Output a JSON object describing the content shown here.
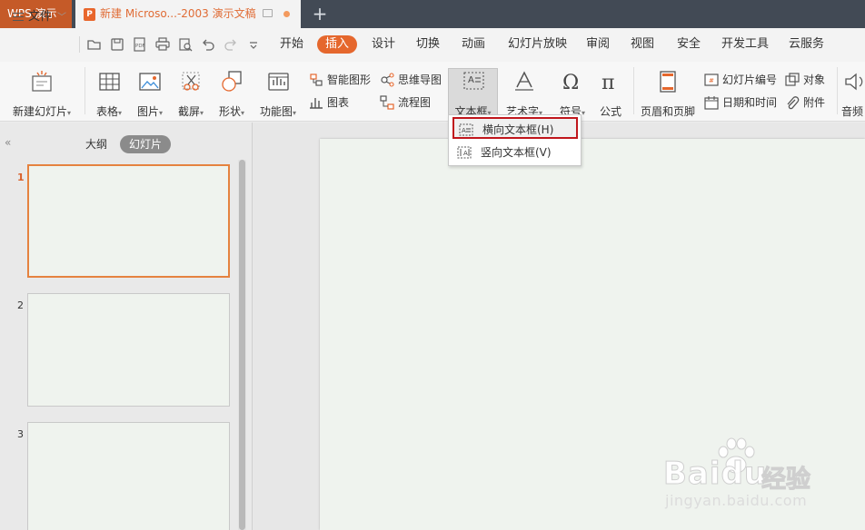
{
  "titlebar": {
    "app_name": "WPS 演示",
    "doc_tab_title": "新建 Microso...-2003 演示文稿",
    "doc_icon_glyph": "P",
    "new_tab_glyph": "+"
  },
  "menubar": {
    "file_label": "文件",
    "tabs": [
      "开始",
      "插入",
      "设计",
      "切换",
      "动画",
      "幻灯片放映",
      "审阅",
      "视图",
      "安全",
      "开发工具",
      "云服务"
    ],
    "active_tab": "插入",
    "quick_access_icons": [
      "open-icon",
      "save-icon",
      "export-pdf-icon",
      "print-icon",
      "print-preview-icon",
      "undo-icon",
      "redo-icon",
      "customize-icon"
    ],
    "pdf_text": "PDF"
  },
  "ribbon": {
    "new_slide": "新建幻灯片",
    "table": "表格",
    "picture": "图片",
    "screenshot": "截屏",
    "shape": "形状",
    "function_chart": "功能图",
    "smart_graphic": "智能图形",
    "chart": "图表",
    "mind_map": "思维导图",
    "flowchart": "流程图",
    "text_box": "文本框",
    "word_art": "艺术字",
    "symbol": "符号",
    "equation": "公式",
    "header_footer": "页眉和页脚",
    "slide_number": "幻灯片编号",
    "date_time": "日期和时间",
    "object": "对象",
    "attachment": "附件",
    "audio": "音频"
  },
  "dropdown": {
    "items": [
      "横向文本框(H)",
      "竖向文本框(V)"
    ],
    "highlighted": "横向文本框(H)"
  },
  "left_pane": {
    "collapse_glyph": "«",
    "tab_outline": "大纲",
    "tab_slides": "幻灯片",
    "slide_numbers": [
      "1",
      "2",
      "3"
    ],
    "active_slide": "1"
  },
  "watermark": {
    "brand": "Baidu",
    "brand_cn": "经验",
    "url": "jingyan.baidu.com"
  },
  "colors": {
    "accent": "#e5672d",
    "titlebar_bg": "#424a55",
    "app_tab_bg": "#c55a28",
    "highlight_border": "#c0161c",
    "slide_bg": "#eff3ee"
  }
}
